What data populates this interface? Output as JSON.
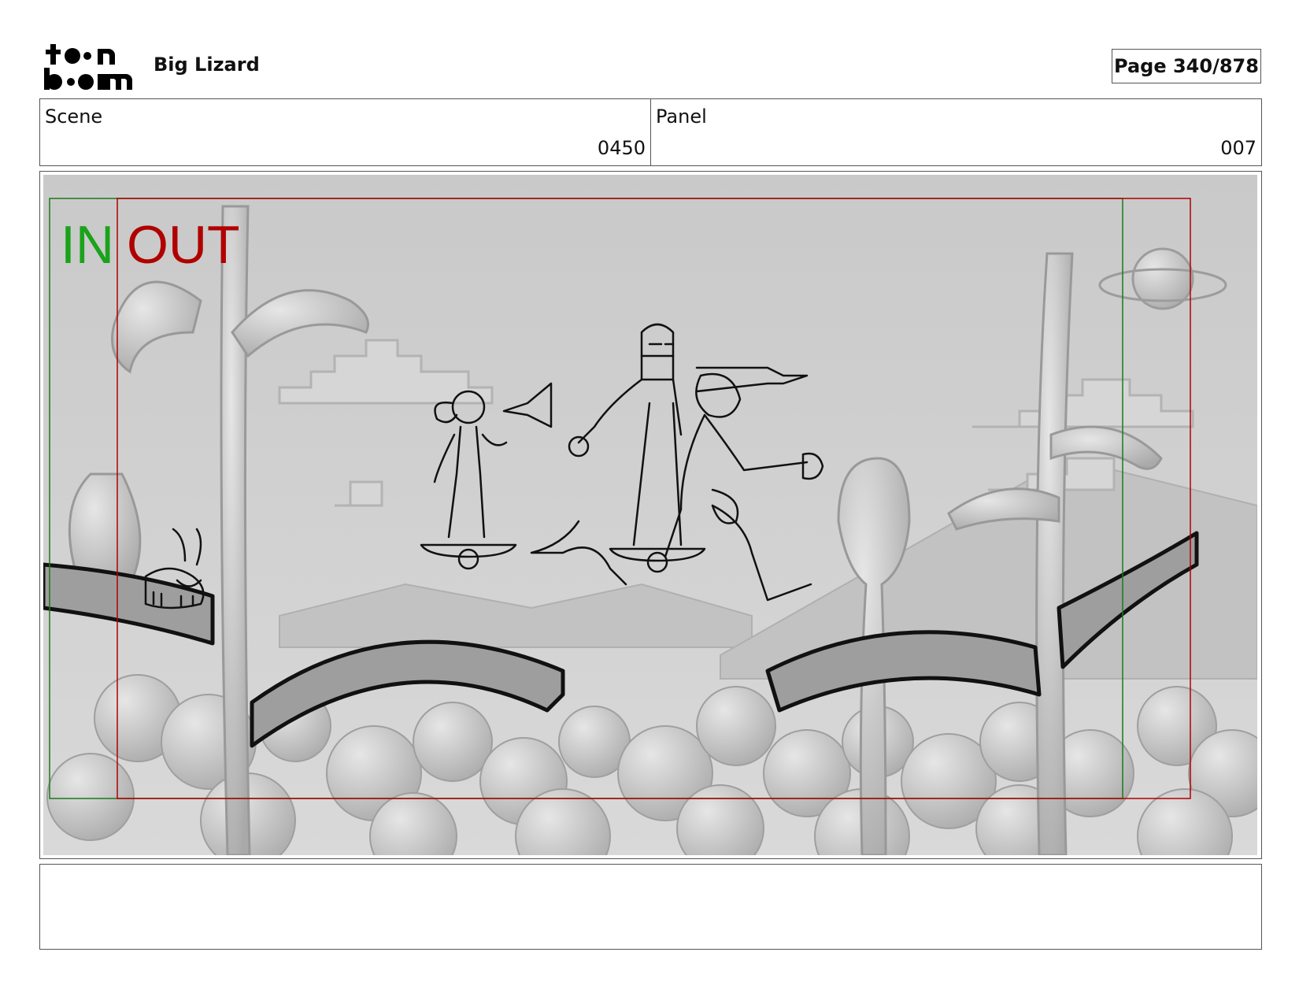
{
  "header": {
    "logo": {
      "icon": "toon-boom-logo",
      "text": "toon boom"
    },
    "project_title": "Big Lizard",
    "page_label": "Page 340/878"
  },
  "info": {
    "scene_label": "Scene",
    "scene_value": "0450",
    "panel_label": "Panel",
    "panel_value": "007"
  },
  "panel": {
    "in_label": "IN",
    "out_label": "OUT",
    "colors": {
      "in": "#1aa31a",
      "out": "#b00000",
      "background": "#cfcfcf"
    }
  },
  "notes": {
    "text": ""
  }
}
